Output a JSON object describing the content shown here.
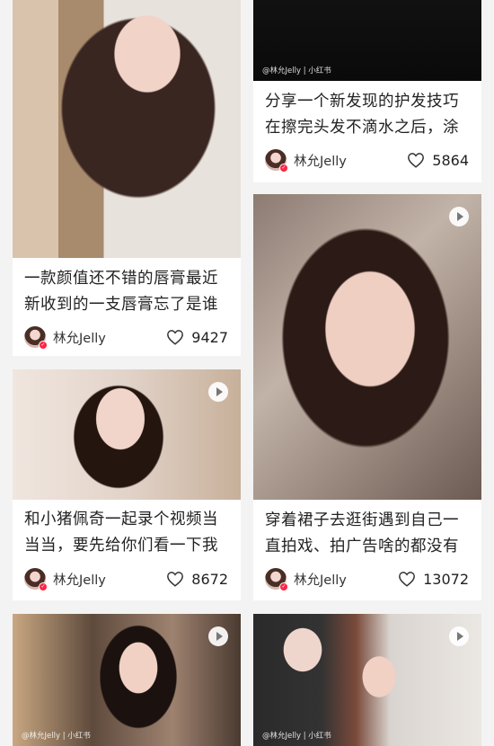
{
  "cards": [
    {
      "title_lines": [
        "一款颜值还不错的唇膏最近",
        "新收到的一支唇膏忘了是谁"
      ],
      "author": "林允Jelly",
      "likes": "9427",
      "video": false,
      "watermark": ""
    },
    {
      "title_lines": [
        "分享一个新发现的护发技巧",
        "在擦完头发不滴水之后，涂"
      ],
      "author": "林允Jelly",
      "likes": "5864",
      "video": false,
      "watermark": "@林允Jelly | 小红书"
    },
    {
      "title_lines": [
        "穿着裙子去逛街遇到自己一",
        "直拍戏、拍广告啥的都没有"
      ],
      "author": "林允Jelly",
      "likes": "13072",
      "video": true,
      "watermark": ""
    },
    {
      "title_lines": [
        "和小猪佩奇一起录个视频当",
        "当当，要先给你们看一下我"
      ],
      "author": "林允Jelly",
      "likes": "8672",
      "video": true,
      "watermark": ""
    },
    {
      "title_lines": [],
      "author": "",
      "likes": "",
      "video": true,
      "watermark": "@林允Jelly | 小红书"
    },
    {
      "title_lines": [],
      "author": "",
      "likes": "",
      "video": true,
      "watermark": "@林允Jelly | 小红书"
    }
  ],
  "icons": {
    "like": "heart-outline-icon",
    "play": "play-icon",
    "verified": "verified-badge-icon"
  },
  "colors": {
    "background": "#f3f3f3",
    "card": "#ffffff",
    "text": "#222222",
    "badge": "#ff2442"
  }
}
